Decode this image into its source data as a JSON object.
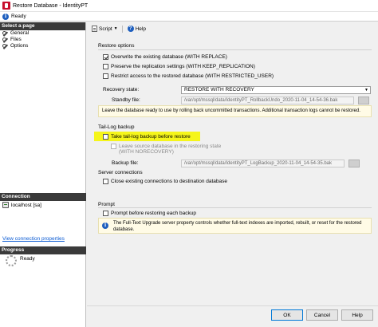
{
  "window": {
    "title": "Restore Database - IdentityPT"
  },
  "status": {
    "text": "Ready",
    "icon": "info-icon"
  },
  "left": {
    "select_page": "Select a page",
    "pages": [
      "General",
      "Files",
      "Options"
    ],
    "connection_head": "Connection",
    "server": "localhost [sa]",
    "view_link": "View connection properties",
    "progress_head": "Progress",
    "progress_status": "Ready"
  },
  "toolbar": {
    "script": "Script",
    "help": "Help"
  },
  "restore_options": {
    "label": "Restore options",
    "overwrite": {
      "label": "Overwrite the existing database (WITH REPLACE)",
      "checked": true
    },
    "preserve": {
      "label": "Preserve the replication settings (WITH KEEP_REPLICATION)",
      "checked": false
    },
    "restrict": {
      "label": "Restrict access to the restored database (WITH RESTRICTED_USER)",
      "checked": false
    },
    "recovery_state_label": "Recovery state:",
    "recovery_state_value": "RESTORE WITH RECOVERY",
    "standby_label": "Standby file:",
    "standby_value": "/var/opt/mssql/data/IdentityPT_RollbackUndo_2020-11-04_14-54-36.bak",
    "note": "Leave the database ready to use by rolling back uncommitted transactions. Additional transaction logs cannot be restored."
  },
  "tail_log": {
    "label": "Tail-Log backup",
    "take_tail": {
      "label": "Take tail-log backup before restore",
      "checked": false
    },
    "leave_source_line1": "Leave source database in the restoring state",
    "leave_source_line2": "(WITH NORECOVERY)",
    "backup_file_label": "Backup file:",
    "backup_file_value": "/var/opt/mssql/data/IdentityPT_LogBackup_2020-11-04_14-54-35.bak"
  },
  "server_connections": {
    "label": "Server connections",
    "close_existing": {
      "label": "Close existing connections to destination database",
      "checked": false
    }
  },
  "prompt": {
    "label": "Prompt",
    "prompt_before": {
      "label": "Prompt before restoring each backup",
      "checked": false
    },
    "info_line1": "The Full-Text Upgrade server property controls whether full-text indexes are imported, rebuilt, or reset for the restored",
    "info_line2": "database."
  },
  "buttons": {
    "ok": "OK",
    "cancel": "Cancel",
    "help": "Help"
  },
  "colors": {
    "highlight": "#f5f51a",
    "section_head": "#3a3a3a",
    "link": "#0b5bd3",
    "info": "#1e5fbf"
  }
}
